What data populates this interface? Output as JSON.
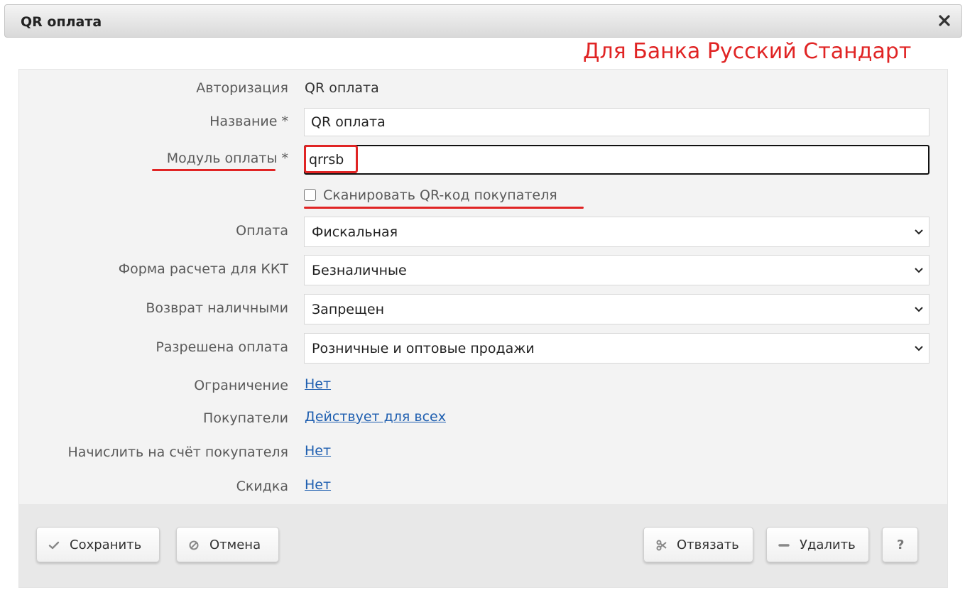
{
  "window": {
    "title": "QR оплата"
  },
  "annotation": {
    "text": "Для Банка Русский Стандарт",
    "color": "#e02424"
  },
  "form": {
    "authorization": {
      "label": "Авторизация",
      "value": "QR оплата"
    },
    "name": {
      "label": "Название *",
      "value": "QR оплата"
    },
    "payment_module": {
      "label": "Модуль оплаты *",
      "value": "qrrsb"
    },
    "scan_qr": {
      "label": "Сканировать QR-код покупателя",
      "checked": false
    },
    "payment": {
      "label": "Оплата",
      "value": "Фискальная"
    },
    "kkt_form": {
      "label": "Форма расчета для ККТ",
      "value": "Безналичные"
    },
    "cash_refund": {
      "label": "Возврат наличными",
      "value": "Запрещен"
    },
    "allowed_payment": {
      "label": "Разрешена оплата",
      "value": "Розничные и оптовые продажи"
    },
    "restriction": {
      "label": "Ограничение",
      "value": "Нет"
    },
    "customers": {
      "label": "Покупатели",
      "value": "Действует для всех"
    },
    "credit_to_account": {
      "label": "Начислить на счёт покупателя",
      "value": "Нет"
    },
    "discount": {
      "label": "Скидка",
      "value": "Нет"
    }
  },
  "buttons": {
    "save": "Сохранить",
    "cancel": "Отмена",
    "unbind": "Отвязать",
    "delete": "Удалить",
    "help": "?"
  },
  "colors": {
    "link": "#1f5fb0",
    "highlight": "#e02424"
  },
  "icons": {
    "close": "close-icon",
    "save": "check-icon",
    "cancel": "ban-icon",
    "unbind": "scissors-icon",
    "delete": "minus-icon",
    "select": "chevron-down-icon"
  }
}
